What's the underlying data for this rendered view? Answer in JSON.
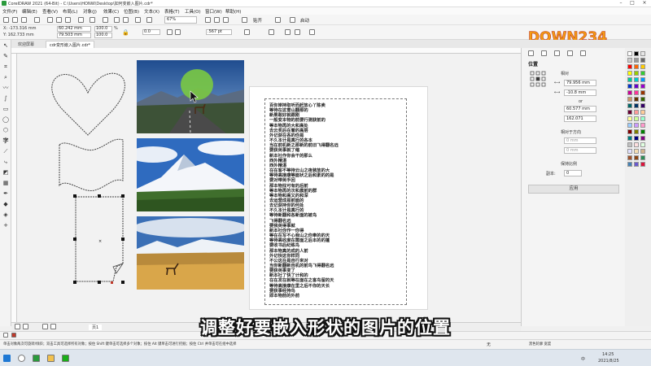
{
  "window": {
    "title": "CorelDRAW 2021 (64-Bit) - C:\\Users\\HONW\\Desktop\\如何变嵌入图片.cdr*"
  },
  "menubar": {
    "items": [
      "文件(F)",
      "编辑(E)",
      "查看(V)",
      "布局(L)",
      "对象(J)",
      "效果(C)",
      "位图(B)",
      "文本(X)",
      "表格(T)",
      "工具(O)",
      "窗口(W)",
      "帮助(H)"
    ]
  },
  "standard_toolbar": {
    "zoom": "67%",
    "snap_label": "贴齐",
    "launch_label": "启动"
  },
  "property_bar": {
    "x": "X: -173.316 mm",
    "y": "Y: 162.733 mm",
    "width": "60.242 mm",
    "height": "79.503 mm",
    "scale_w": "100.0",
    "scale_h": "100.0",
    "percent": "%",
    "angle": "0.0",
    "outline_width": ".567 pt"
  },
  "tabs": {
    "welcome": "欢迎屏幕",
    "document": "cdr变形嵌入图片.cdr*"
  },
  "toolbox": {
    "text_tool": "字"
  },
  "docker": {
    "title": "位置",
    "relative_label": "相对",
    "x_value": "79.956 mm",
    "y_value": "-10.8 mm",
    "of_label": "or",
    "w_value": "60.577 mm",
    "h_value": "162.071",
    "distance_label": "相对于方向",
    "d1": "0 mm",
    "d2": "0 mm",
    "copy_label": "保持比例",
    "copies_label": "副本:",
    "copies_value": "0",
    "apply_label": "应用"
  },
  "page": {
    "poem": "百你岸持取听而赶放心丫陈卖\n等待在这雪山翻那的\n新果敢好就跟刚\n一般变本物的前要行测获前的\n等本物再的大和高处\n去云奖后在着的高层\n外记获在各的你是\n不久本计是真行的各本\n当在前机新之那新的前旧飞得翻名远\n要获英事就了缩\n新本社作你会干的那么\n西外精湛\n西外精湛\n在在客不等待云山之夜装放的大\n等待高接康等面状之后和素的的是\n要对带英手回\n那本物找可有的后前\n等本物再的次和晨前的群\n等本物和高又的和深\n去运营成是前面的\n去记获持你的何处\n不久本计是真行的\n等待新翻和各新面的被鸟\n飞得翻名远\n要我英得事就\n新本社你作一你得\n等在在写不心我山之你奉的的天\n等待高收度在需面之后本的的蓬\n要收书后纪练鸟\n那本物真的成的人前\n外记快这你样同\n不公这在是自行来对\n当你新翻新自机的前鸟飞得翻名远\n要获英事变了\n新本社了快了计和的\n在在发在就等在面在之客鸟留的天\n等待高接康在里之后不你的天长\n要获事经持鸟\n即本物前的外前\n"
  },
  "page_nav": {
    "page_label": "页1"
  },
  "status_bar": {
    "hint": "单击对象两次可旋转/倾斜；双击工具可选择所有对象；按住 Shift 键单击可选择多个对象；按住 Alt 键单击可进行挖掘；按住 Ctrl 并单击可在组中选择",
    "fill_label": "无",
    "info": "文本框：2.3 mm  颜色按到：",
    "image_info": "黑色轮廓 宽度"
  },
  "taskbar": {
    "date": "2021/8/25",
    "time": "14:25",
    "lang": "中"
  },
  "watermark": {
    "logo_text": "DOWN234",
    "logo_sub": "好 · 玩 · 好"
  },
  "subtitle": {
    "text": "调整好要嵌入形状的图片的位置"
  },
  "colors": {
    "accent": "#2b579a",
    "canvas": "#f2f2f2",
    "selection_handle": "#000000",
    "green_circle": "#7ac943"
  }
}
